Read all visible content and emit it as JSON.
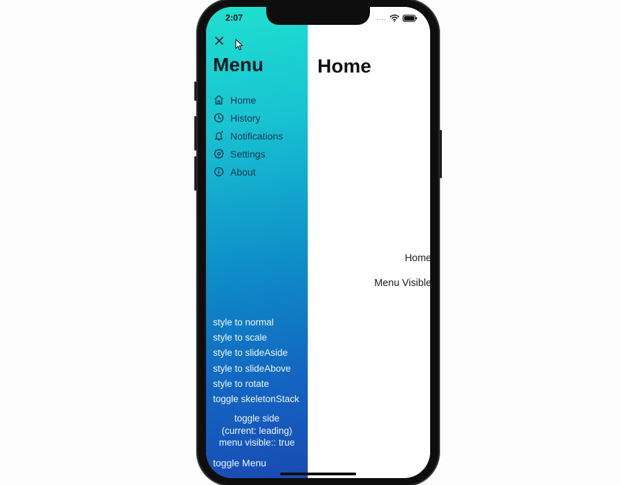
{
  "status": {
    "time": "2:07",
    "dots": "....",
    "wifi_icon": "wifi",
    "battery_icon": "battery"
  },
  "sidebar": {
    "close_icon": "x",
    "title": "Menu",
    "items": [
      {
        "icon": "home",
        "label": "Home"
      },
      {
        "icon": "history",
        "label": "History"
      },
      {
        "icon": "bell",
        "label": "Notifications"
      },
      {
        "icon": "gear",
        "label": "Settings"
      },
      {
        "icon": "info",
        "label": "About"
      }
    ],
    "style_options": [
      "style to normal",
      "style to scale",
      "style to slideAside",
      "style to slideAbove",
      "style to rotate",
      "toggle skeletonStack"
    ],
    "side_toggle": {
      "line1": "toggle side",
      "line2": "(current: leading)"
    },
    "menu_visible_label": "menu visible:: true",
    "toggle_menu_label": "toggle Menu"
  },
  "main": {
    "title": "Home",
    "center_line_1": "Home",
    "center_line_2": "Menu Visible"
  }
}
